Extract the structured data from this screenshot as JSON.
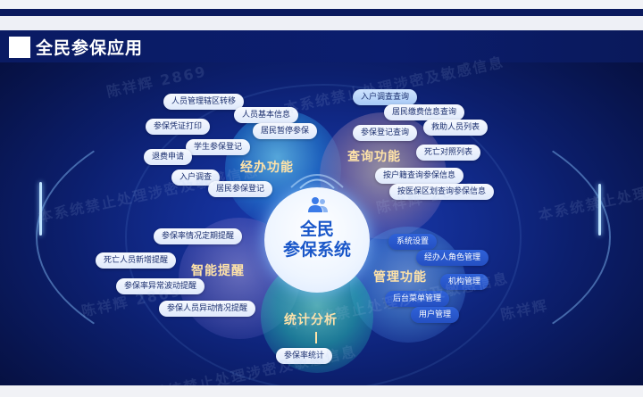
{
  "header": {
    "title": "全民参保应用"
  },
  "center": {
    "line1": "全民",
    "line2": "参保系统",
    "icon": "user-group-icon"
  },
  "categories": {
    "jingban": "经办功能",
    "chaxun": "查询功能",
    "zhineng": "智能提醒",
    "guanli": "管理功能",
    "tongji": "统计分析"
  },
  "jingban_items": [
    "人员管理辖区转移",
    "人员基本信息",
    "参保凭证打印",
    "居民暂停参保",
    "学生参保登记",
    "退费申请",
    "入户调查",
    "居民参保登记"
  ],
  "chaxun_items": [
    "入户调查查询",
    "居民缴费信息查询",
    "参保登记查询",
    "救助人员列表",
    "死亡对照列表",
    "按户籍查询参保信息",
    "按医保区划查询参保信息"
  ],
  "zhineng_items": [
    "参保率情况定期提醒",
    "死亡人员新增提醒",
    "参保率异常波动提醒",
    "参保人员异动情况提醒"
  ],
  "guanli_items": [
    "系统设置",
    "经办人角色管理",
    "机构管理",
    "后台菜单管理",
    "用户管理"
  ],
  "tongji_items": [
    "参保率统计"
  ],
  "watermarks": [
    "陈祥辉 2869",
    "本系统禁止处理涉密及敏感信息",
    "本系统禁止处理涉密及敏感信息",
    "陈祥辉 2869",
    "本系统禁止处理涉密及敏感信息",
    "陈祥辉 2869",
    "本系统禁止处理涉密及敏感信息",
    "陈祥辉",
    "本系统禁止处理涉密及敏感信息"
  ],
  "colors": {
    "background": "#0c1f6e",
    "accent_text": "#ffe3a8",
    "center_text": "#1a57c9"
  }
}
